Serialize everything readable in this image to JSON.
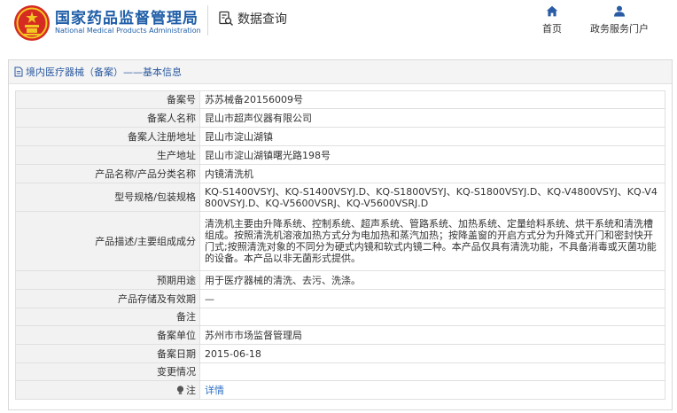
{
  "header": {
    "org_cn": "国家药品监督管理局",
    "org_en": "National Medical Products Administration",
    "query_label": "数据查询",
    "nav": [
      {
        "label": "首页",
        "icon": "home-icon"
      },
      {
        "label": "政务服务门户",
        "icon": "user-icon"
      }
    ]
  },
  "panel": {
    "title": "境内医疗器械（备案）——基本信息"
  },
  "record": {
    "rows": [
      {
        "label": "备案号",
        "value": "苏苏械备20156009号"
      },
      {
        "label": "备案人名称",
        "value": "昆山市超声仪器有限公司"
      },
      {
        "label": "备案人注册地址",
        "value": "昆山市淀山湖镇"
      },
      {
        "label": "生产地址",
        "value": "昆山市淀山湖镇曙光路198号"
      },
      {
        "label": "产品名称/产品分类名称",
        "value": "内镜清洗机"
      },
      {
        "label": "型号规格/包装规格",
        "value": "KQ-S1400VSYJ、KQ-S1400VSYJ.D、KQ-S1800VSYJ、KQ-S1800VSYJ.D、KQ-V4800VSYJ、KQ-V4800VSYJ.D、KQ-V5600VSRJ、KQ-V5600VSRJ.D"
      },
      {
        "label": "产品描述/主要组成成分",
        "value": "清洗机主要由升降系统、控制系统、超声系统、管路系统、加热系统、定量给料系统、烘干系统和清洗槽组成。按照清洗机溶液加热方式分为电加热和蒸汽加热；按降盖窗的开启方式分为升降式开门和密封快开门式;按照清洗对象的不同分为硬式内镜和软式内镜二种。本产品仅具有清洗功能，不具备消毒或灭菌功能的设备。本产品以非无菌形式提供。"
      },
      {
        "label": "预期用途",
        "value": "用于医疗器械的清洗、去污、洗涤。"
      },
      {
        "label": "产品存储及有效期",
        "value": "—"
      },
      {
        "label": "备注",
        "value": ""
      },
      {
        "label": "备案单位",
        "value": "苏州市市场监督管理局"
      },
      {
        "label": "备案日期",
        "value": "2015-06-18"
      },
      {
        "label": "变更情况",
        "value": ""
      }
    ],
    "note_label": "注",
    "note_link": "详情"
  },
  "colors": {
    "brand_blue": "#1f5ea8",
    "link_blue": "#2f6fc1",
    "label_bg": "#f2f2f2",
    "logo_red": "#d62b22",
    "logo_gold": "#f3c623"
  }
}
